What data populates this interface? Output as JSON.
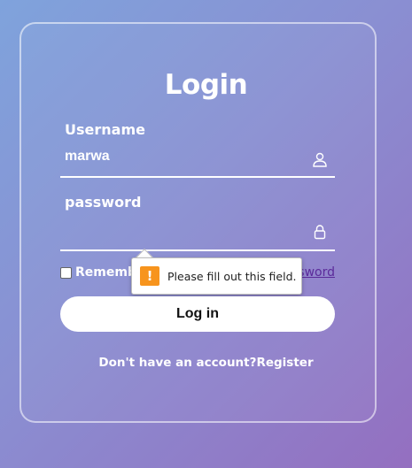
{
  "form": {
    "title": "Login",
    "username": {
      "label": "Username",
      "value": "marwa"
    },
    "password": {
      "label": "password",
      "value": ""
    },
    "remember_label": "Rememb",
    "forgot_label": "password",
    "submit_label": "Log in",
    "register_prompt": "Don't have an account?",
    "register_label": "Register"
  },
  "validation": {
    "message": "Please fill out this field.",
    "icon": "warning-icon"
  },
  "colors": {
    "accent_link": "#5b2a9a",
    "warning": "#f7941d"
  }
}
